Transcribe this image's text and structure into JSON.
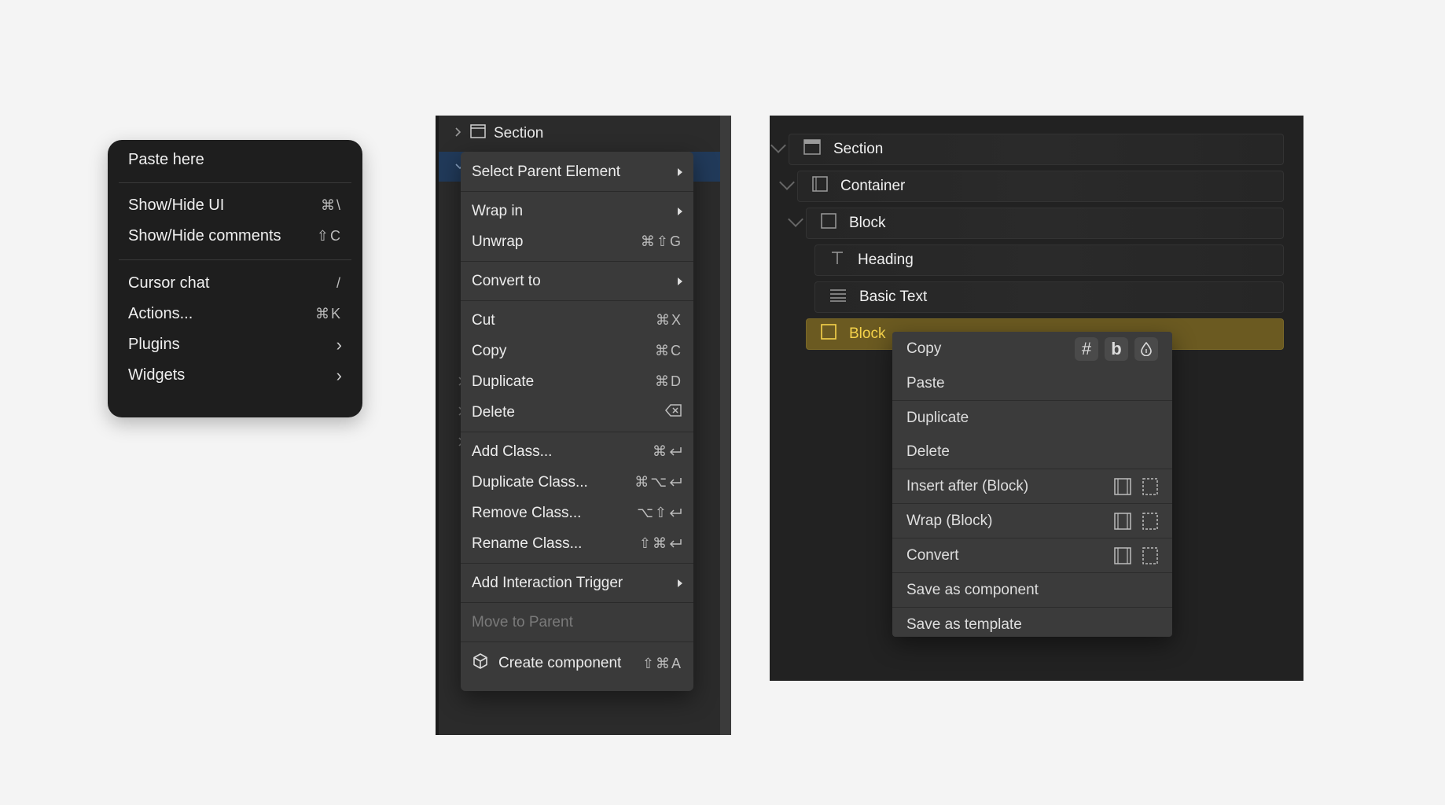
{
  "menu1": {
    "paste": "Paste here",
    "show_hide_ui": "Show/Hide UI",
    "show_hide_ui_shortcut": "⌘\\",
    "show_hide_comments": "Show/Hide comments",
    "show_hide_comments_shortcut": "⇧C",
    "cursor_chat": "Cursor chat",
    "cursor_chat_shortcut": "/",
    "actions": "Actions...",
    "actions_shortcut": "⌘K",
    "plugins": "Plugins",
    "widgets": "Widgets",
    "submenu_chevron": "›"
  },
  "panel2": {
    "section_label": "Section",
    "menu": {
      "select_parent": "Select Parent Element",
      "wrap_in": "Wrap in",
      "unwrap": "Unwrap",
      "unwrap_shortcut": "⌘⇧G",
      "convert_to": "Convert to",
      "cut": "Cut",
      "cut_shortcut": "⌘X",
      "copy": "Copy",
      "copy_shortcut": "⌘C",
      "duplicate": "Duplicate",
      "duplicate_shortcut": "⌘D",
      "delete": "Delete",
      "add_class": "Add Class...",
      "duplicate_class": "Duplicate Class...",
      "remove_class": "Remove Class...",
      "rename_class": "Rename Class...",
      "add_interaction": "Add Interaction Trigger",
      "move_to_parent": "Move to Parent",
      "create_component": "Create component",
      "create_component_shortcut": "⇧⌘A"
    }
  },
  "panel3": {
    "tree": {
      "section": "Section",
      "container": "Container",
      "block": "Block",
      "heading": "Heading",
      "basic_text": "Basic Text",
      "block_selected": "Block"
    },
    "menu": {
      "copy": "Copy",
      "paste": "Paste",
      "duplicate": "Duplicate",
      "delete": "Delete",
      "insert_after": "Insert after (Block)",
      "wrap": "Wrap (Block)",
      "convert": "Convert",
      "save_component": "Save as component",
      "save_template": "Save as template",
      "copy_hash": "#",
      "copy_b": "b"
    }
  },
  "colors": {
    "page_bg": "#f4f4f4",
    "menu_dark": "#1e1e1e",
    "selection_blue": "#213a5a",
    "highlight_yellow": "#6b5a21",
    "highlight_text": "#f6d34a"
  }
}
